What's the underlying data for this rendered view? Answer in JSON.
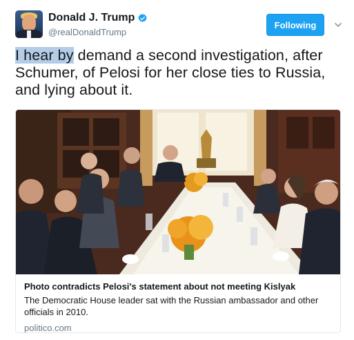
{
  "user": {
    "display_name": "Donald J. Trump",
    "handle": "@realDonaldTrump",
    "verified_icon": "verified-badge-icon",
    "avatar_icon": "profile-photo"
  },
  "follow_button": {
    "label": "Following",
    "color": "#1da1f2"
  },
  "menu_icon": "chevron-down-icon",
  "tweet": {
    "highlighted": "I hear by",
    "rest": " demand a second investigation, after Schumer, of Pelosi for her close ties to Russia, and lying about it.",
    "highlight_color": "#b4cde7"
  },
  "card": {
    "title": "Photo contradicts Pelosi's statement about not meeting Kislyak",
    "description": "The Democratic House leader sat with the Russian ambassador and other officials in 2010.",
    "domain": "politico.com"
  }
}
